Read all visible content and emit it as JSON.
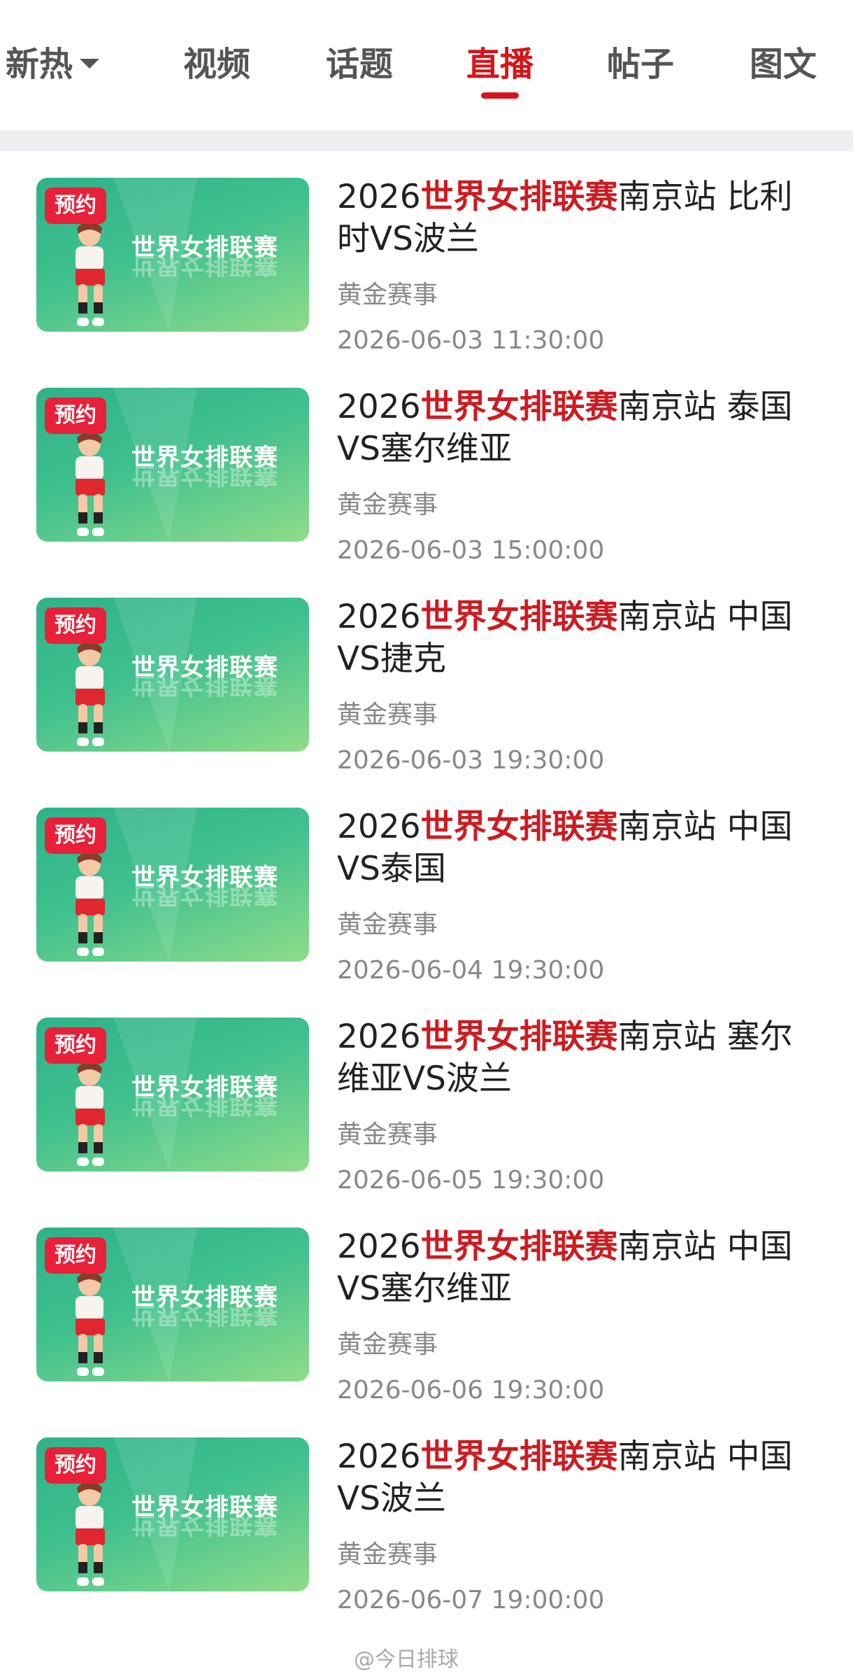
{
  "tabs": [
    {
      "label": "新热",
      "has_dropdown": true,
      "active": false
    },
    {
      "label": "视频",
      "active": false
    },
    {
      "label": "话题",
      "active": false
    },
    {
      "label": "直播",
      "active": true
    },
    {
      "label": "帖子",
      "active": false
    },
    {
      "label": "图文",
      "active": false
    }
  ],
  "accent_color": "#d7151a",
  "items": [
    {
      "badge": "预约",
      "thumb_title": "世界女排联赛",
      "title_prefix": "2026",
      "title_highlight": "世界女排联赛",
      "title_suffix": "南京站 比利时VS波兰",
      "tag": "黄金赛事",
      "time": "2026-06-03 11:30:00"
    },
    {
      "badge": "预约",
      "thumb_title": "世界女排联赛",
      "title_prefix": "2026",
      "title_highlight": "世界女排联赛",
      "title_suffix": "南京站 泰国VS塞尔维亚",
      "tag": "黄金赛事",
      "time": "2026-06-03 15:00:00"
    },
    {
      "badge": "预约",
      "thumb_title": "世界女排联赛",
      "title_prefix": "2026",
      "title_highlight": "世界女排联赛",
      "title_suffix": "南京站 中国VS捷克",
      "tag": "黄金赛事",
      "time": "2026-06-03 19:30:00"
    },
    {
      "badge": "预约",
      "thumb_title": "世界女排联赛",
      "title_prefix": "2026",
      "title_highlight": "世界女排联赛",
      "title_suffix": "南京站 中国VS泰国",
      "tag": "黄金赛事",
      "time": "2026-06-04 19:30:00"
    },
    {
      "badge": "预约",
      "thumb_title": "世界女排联赛",
      "title_prefix": "2026",
      "title_highlight": "世界女排联赛",
      "title_suffix": "南京站 塞尔维亚VS波兰",
      "tag": "黄金赛事",
      "time": "2026-06-05 19:30:00"
    },
    {
      "badge": "预约",
      "thumb_title": "世界女排联赛",
      "title_prefix": "2026",
      "title_highlight": "世界女排联赛",
      "title_suffix": "南京站 中国VS塞尔维亚",
      "tag": "黄金赛事",
      "time": "2026-06-06 19:30:00"
    },
    {
      "badge": "预约",
      "thumb_title": "世界女排联赛",
      "title_prefix": "2026",
      "title_highlight": "世界女排联赛",
      "title_suffix": "南京站 中国VS波兰",
      "tag": "黄金赛事",
      "time": "2026-06-07 19:00:00"
    }
  ],
  "watermark": "@今日排球"
}
